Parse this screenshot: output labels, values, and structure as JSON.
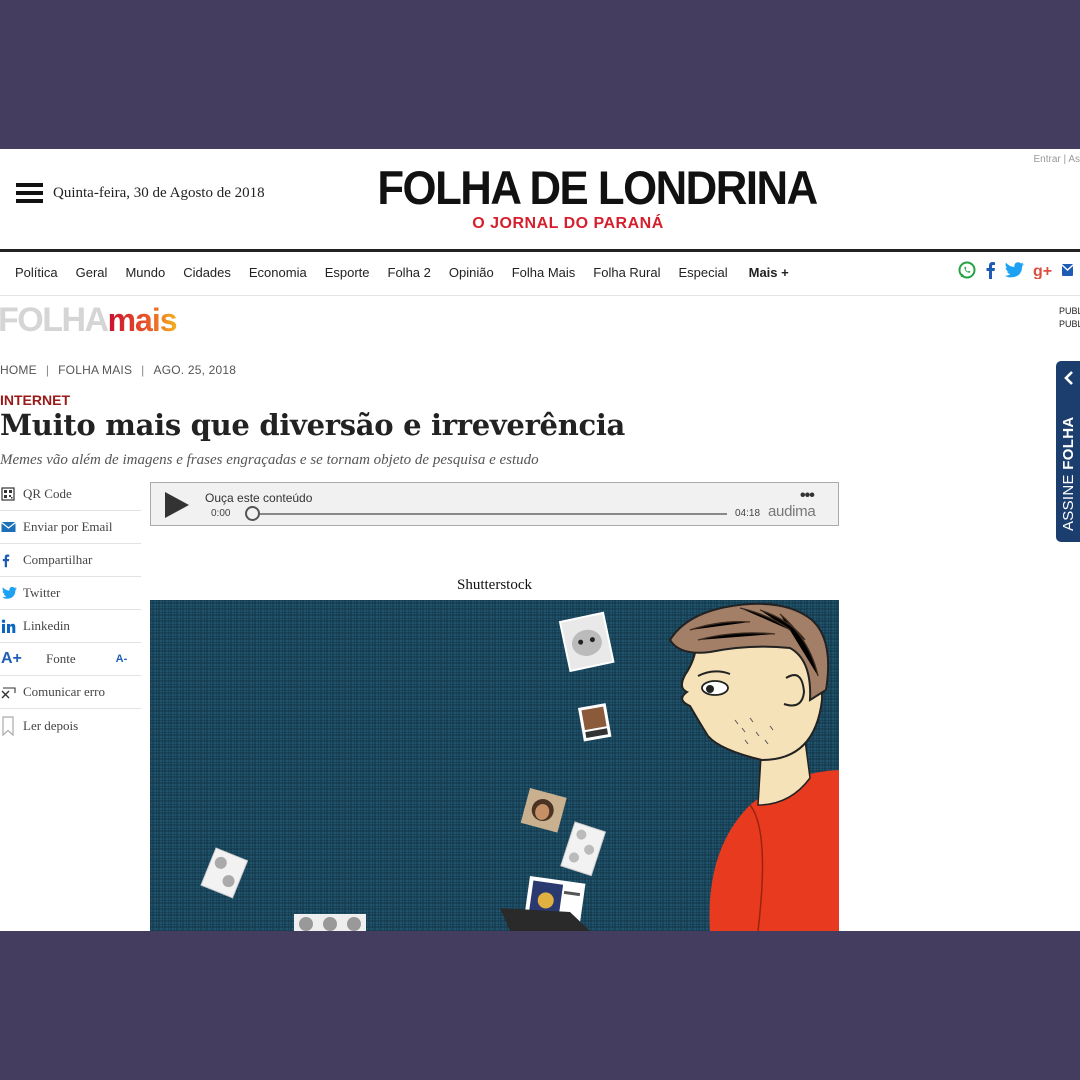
{
  "header": {
    "login_links": "Entrar | As",
    "date": "Quinta-feira, 30 de Agosto de 2018",
    "title": "FOLHA DE LONDRINA",
    "tagline": "O JORNAL DO PARANÁ"
  },
  "nav": {
    "items": [
      "Política",
      "Geral",
      "Mundo",
      "Cidades",
      "Economia",
      "Esporte",
      "Folha 2",
      "Opinião",
      "Folha Mais",
      "Folha Rural",
      "Especial"
    ],
    "more": "Mais +"
  },
  "social": [
    {
      "icon": "whatsapp-icon",
      "color": "#25a244"
    },
    {
      "icon": "facebook-icon",
      "color": "#1d5bb5"
    },
    {
      "icon": "twitter-icon",
      "color": "#1da1f2"
    },
    {
      "icon": "google-plus-icon",
      "color": "#dc4e41"
    },
    {
      "icon": "email-icon",
      "color": "#1d5bb5"
    }
  ],
  "section_logo": {
    "part1": "FOLHA",
    "part2": "mais"
  },
  "pub_labels": [
    "PUBL",
    "PUBL"
  ],
  "breadcrumb": {
    "home": "HOME",
    "section": "FOLHA MAIS",
    "date": "AGO. 25, 2018"
  },
  "article": {
    "kicker": "INTERNET",
    "headline": "Muito mais que diversão e irreverência",
    "subhead": "Memes vão além de imagens e frases engraçadas e se tornam objeto de pesquisa e estudo",
    "image_credit": "Shutterstock"
  },
  "tools": {
    "qr": "QR Code",
    "email": "Enviar por Email",
    "share": "Compartilhar",
    "twitter": "Twitter",
    "linkedin": "Linkedin",
    "font_up": "A+",
    "font_label": "Fonte",
    "font_down": "A-",
    "report": "Comunicar erro",
    "later": "Ler depois"
  },
  "player": {
    "title": "Ouça este conteúdo",
    "time_start": "0:00",
    "time_end": "04:18",
    "brand": "audima",
    "progress": 0
  },
  "subscribe": {
    "part1": "ASSINE ",
    "part2": "FOLHA"
  },
  "colors": {
    "brand_red": "#d61f2c",
    "kicker": "#9a1a1a",
    "accent_blue": "#1c3e6e",
    "frame": "#443d60"
  }
}
